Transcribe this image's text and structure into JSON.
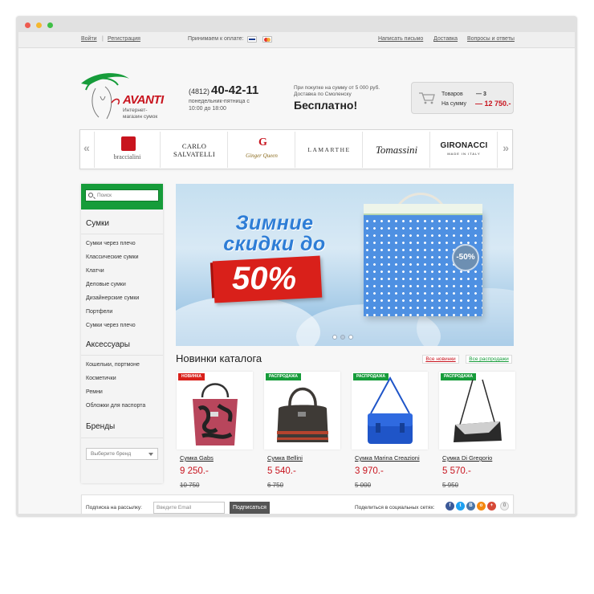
{
  "colors": {
    "brand_red": "#c8141e",
    "brand_green": "#169c3a",
    "banner_blue": "#2e7dd6"
  },
  "topbar": {
    "login": "Войти",
    "separator": "|",
    "register": "Регистрация",
    "payment_label": "Принимаем к оплате:",
    "payment_icons": [
      "visa-icon",
      "mastercard-icon"
    ],
    "write_letter": "Написать письмо",
    "delivery": "Доставка",
    "faq": "Вопросы и ответы"
  },
  "header": {
    "logo_text": "AVANTI",
    "logo_sub": "Интернет-магазин сумок",
    "phone_code": "(4812)",
    "phone_number": "40-42-11",
    "hours": "понедельник-пятница с 10:00 до 18:00",
    "promo": "При покупке на сумму от 5 000 руб. Доставка по Смоленску",
    "free": "Бесплатно!"
  },
  "cart": {
    "items_label": "Товаров",
    "dash": "—",
    "count": "3",
    "sum_label": "На сумму",
    "sum": "12 750.-"
  },
  "brands": {
    "prev": "«",
    "next": "»",
    "items": [
      {
        "name": "braccialini"
      },
      {
        "name": "CARLO SALVATELLI"
      },
      {
        "name": "Ginger Queen",
        "mark": "G"
      },
      {
        "name": "LAMARTHE"
      },
      {
        "name": "Tomassini"
      },
      {
        "name": "GIRONACCI",
        "sub": "MADE IN ITALY"
      }
    ]
  },
  "sidebar": {
    "search_placeholder": "Поиск",
    "categories": [
      {
        "title": "Сумки",
        "items": [
          "Сумки через плечо",
          "Классические сумки",
          "Клатчи",
          "Деловые сумки",
          "Дизайнерские сумки",
          "Портфели",
          "Сумки через плечо"
        ]
      },
      {
        "title": "Аксессуары",
        "items": [
          "Кошельки, портмоне",
          "Косметички",
          "Ремни",
          "Обложки для паспорта"
        ]
      },
      {
        "title": "Бренды",
        "items": []
      }
    ],
    "brand_select": "Выберите бренд"
  },
  "banner": {
    "title": "Зимние скидки до",
    "discount": "50%",
    "tag": "-50%",
    "slides_count": 3,
    "active_slide": 2
  },
  "catalog": {
    "title": "Новинки каталога",
    "all_new": "Все новинки",
    "all_sale": "Все распродажи",
    "products": [
      {
        "badge": "НОВИНКА",
        "badge_type": "new",
        "name": "Сумка Gabs",
        "price": "9 250.-",
        "old_price": "10 750",
        "color": "#b8465c"
      },
      {
        "badge": "РАСПРОДАЖА",
        "badge_type": "sale",
        "name": "Сумка Bellini",
        "price": "5 540.-",
        "old_price": "6 750",
        "color": "#3e3a36"
      },
      {
        "badge": "РАСПРОДАЖА",
        "badge_type": "sale",
        "name": "Сумка Marina Creazioni",
        "price": "3 970.-",
        "old_price": "5 000",
        "color": "#1f55c8"
      },
      {
        "badge": "РАСПРОДАЖА",
        "badge_type": "sale",
        "name": "Сумка Di Gregorio",
        "price": "5 570.-",
        "old_price": "5 950",
        "color": "#2a2a2a"
      }
    ]
  },
  "footer": {
    "subscribe_label": "Подписка на рассылку:",
    "email_placeholder": "Введите Email",
    "subscribe_btn": "Подписаться",
    "share_label": "Поделиться в социальных сетях:",
    "social": [
      {
        "icon": "facebook-icon",
        "glyph": "f",
        "color": "#3b5998"
      },
      {
        "icon": "twitter-icon",
        "glyph": "t",
        "color": "#1da1f2"
      },
      {
        "icon": "vk-icon",
        "glyph": "B",
        "color": "#4a76a8"
      },
      {
        "icon": "odnoklassniki-icon",
        "glyph": "o",
        "color": "#f5880f"
      },
      {
        "icon": "google-plus-icon",
        "glyph": "+",
        "color": "#d64937"
      }
    ],
    "share_count": "0"
  }
}
